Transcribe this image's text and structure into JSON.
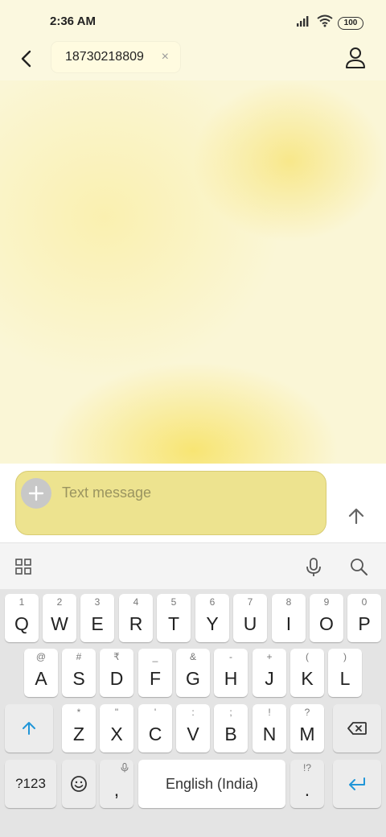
{
  "status_bar": {
    "time": "2:36 AM",
    "battery": "100"
  },
  "header": {
    "recipient": "18730218809",
    "chip_close": "×"
  },
  "composer": {
    "placeholder": "Text message"
  },
  "keyboard": {
    "row1": [
      {
        "letter": "Q",
        "hint": "1"
      },
      {
        "letter": "W",
        "hint": "2"
      },
      {
        "letter": "E",
        "hint": "3"
      },
      {
        "letter": "R",
        "hint": "4"
      },
      {
        "letter": "T",
        "hint": "5"
      },
      {
        "letter": "Y",
        "hint": "6"
      },
      {
        "letter": "U",
        "hint": "7"
      },
      {
        "letter": "I",
        "hint": "8"
      },
      {
        "letter": "O",
        "hint": "9"
      },
      {
        "letter": "P",
        "hint": "0"
      }
    ],
    "row2": [
      {
        "letter": "A",
        "hint": "@"
      },
      {
        "letter": "S",
        "hint": "#"
      },
      {
        "letter": "D",
        "hint": "₹"
      },
      {
        "letter": "F",
        "hint": "_"
      },
      {
        "letter": "G",
        "hint": "&"
      },
      {
        "letter": "H",
        "hint": "-"
      },
      {
        "letter": "J",
        "hint": "+"
      },
      {
        "letter": "K",
        "hint": "("
      },
      {
        "letter": "L",
        "hint": ")"
      }
    ],
    "row3": [
      {
        "letter": "Z",
        "hint": "*"
      },
      {
        "letter": "X",
        "hint": "\""
      },
      {
        "letter": "C",
        "hint": "'"
      },
      {
        "letter": "V",
        "hint": ":"
      },
      {
        "letter": "B",
        "hint": ";"
      },
      {
        "letter": "N",
        "hint": "!"
      },
      {
        "letter": "M",
        "hint": "?"
      }
    ],
    "symbols_label": "?123",
    "comma": ",",
    "space_label": "English (India)",
    "period": ".",
    "period_hint": "!?"
  },
  "colors": {
    "accent": "#2196d8",
    "composer_fill": "#ede38f",
    "keyboard_bg": "#e4e4e4"
  }
}
